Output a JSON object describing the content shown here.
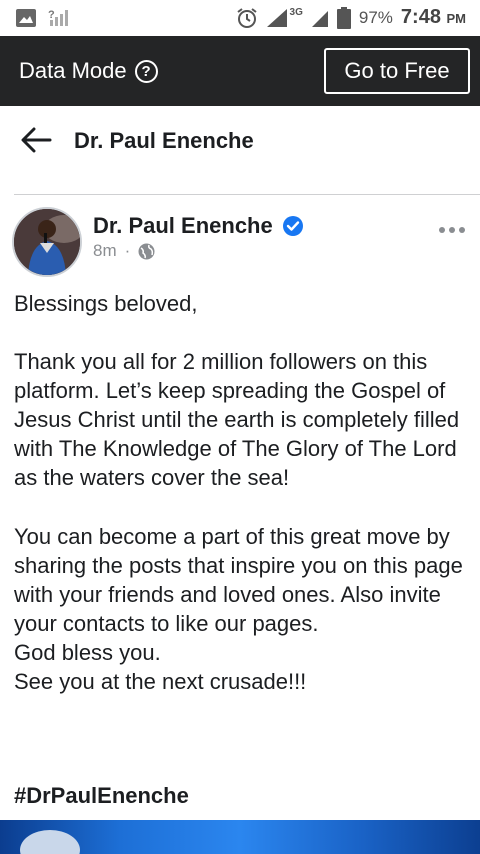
{
  "status_bar": {
    "battery": "97%",
    "time": "7:48",
    "time_suffix": "PM",
    "network": "3G"
  },
  "data_bar": {
    "label": "Data Mode",
    "info_glyph": "?",
    "action_label": "Go to Free"
  },
  "header": {
    "title": "Dr. Paul Enenche"
  },
  "post": {
    "author": "Dr. Paul Enenche",
    "time": "8m",
    "separator": "·",
    "paragraphs": [
      "Blessings beloved,",
      "Thank you all for 2 million followers on this platform. Let’s keep spreading the Gospel of Jesus Christ until the earth is completely filled with The Knowledge of The Glory of The Lord as the waters cover the sea!",
      "You can become a part of this great move by sharing the posts that inspire you on this page with your friends and loved ones. Also invite your contacts to like our pages.\nGod bless you.\nSee you at the next crusade!!!"
    ],
    "hashtag": "#DrPaulEnenche"
  },
  "colors": {
    "data_bar_bg": "#242526",
    "verified_blue": "#1877f2",
    "meta_gray": "#8a8d91"
  },
  "icons": {
    "back": "arrow-left-icon",
    "verified": "verified-badge-icon",
    "privacy": "globe-icon",
    "more": "more-horizontal-icon",
    "info": "info-circle-icon"
  }
}
